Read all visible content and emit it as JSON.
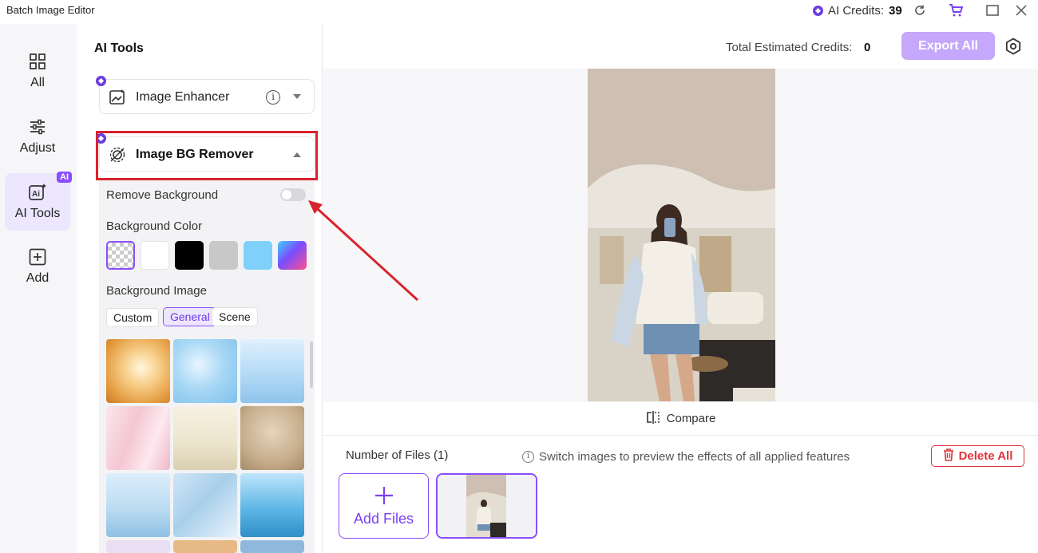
{
  "window": {
    "title": "Batch Image Editor",
    "credits_label": "AI Credits:",
    "credits_value": "39",
    "icons": [
      "refresh-icon",
      "cart-icon",
      "maximize-icon",
      "close-icon"
    ]
  },
  "rail": {
    "items": [
      {
        "label": "All",
        "icon": "grid-icon"
      },
      {
        "label": "Adjust",
        "icon": "sliders-icon"
      },
      {
        "label": "AI Tools",
        "icon": "ai-icon",
        "badge": "AI",
        "active": true
      },
      {
        "label": "Add",
        "icon": "plus-square-icon"
      }
    ]
  },
  "panel": {
    "title": "AI Tools",
    "enhancer": {
      "label": "Image Enhancer"
    },
    "bg_remover": {
      "label": "Image BG Remover",
      "remove_background_label": "Remove Background",
      "remove_background_on": false,
      "bg_color_label": "Background Color",
      "colors": [
        "transparent",
        "#ffffff",
        "#000000",
        "#c8c8c8",
        "#7fd0fb",
        "gradient"
      ],
      "bg_image_label": "Background Image",
      "tabs": [
        {
          "label": "Custom",
          "active": false
        },
        {
          "label": "General",
          "active": true
        },
        {
          "label": "Scene",
          "active": false
        }
      ]
    }
  },
  "topbar": {
    "estimated_label": "Total Estimated Credits:",
    "estimated_value": "0",
    "export_label": "Export All"
  },
  "preview": {
    "compare_label": "Compare"
  },
  "files": {
    "count_label": "Number of Files (1)",
    "hint": "Switch images to preview the effects of all applied features",
    "delete_label": "Delete All",
    "add_label": "Add Files"
  },
  "colors": {
    "accent": "#8a4dff",
    "danger": "#e0343c",
    "highlight": "#d9232d"
  }
}
